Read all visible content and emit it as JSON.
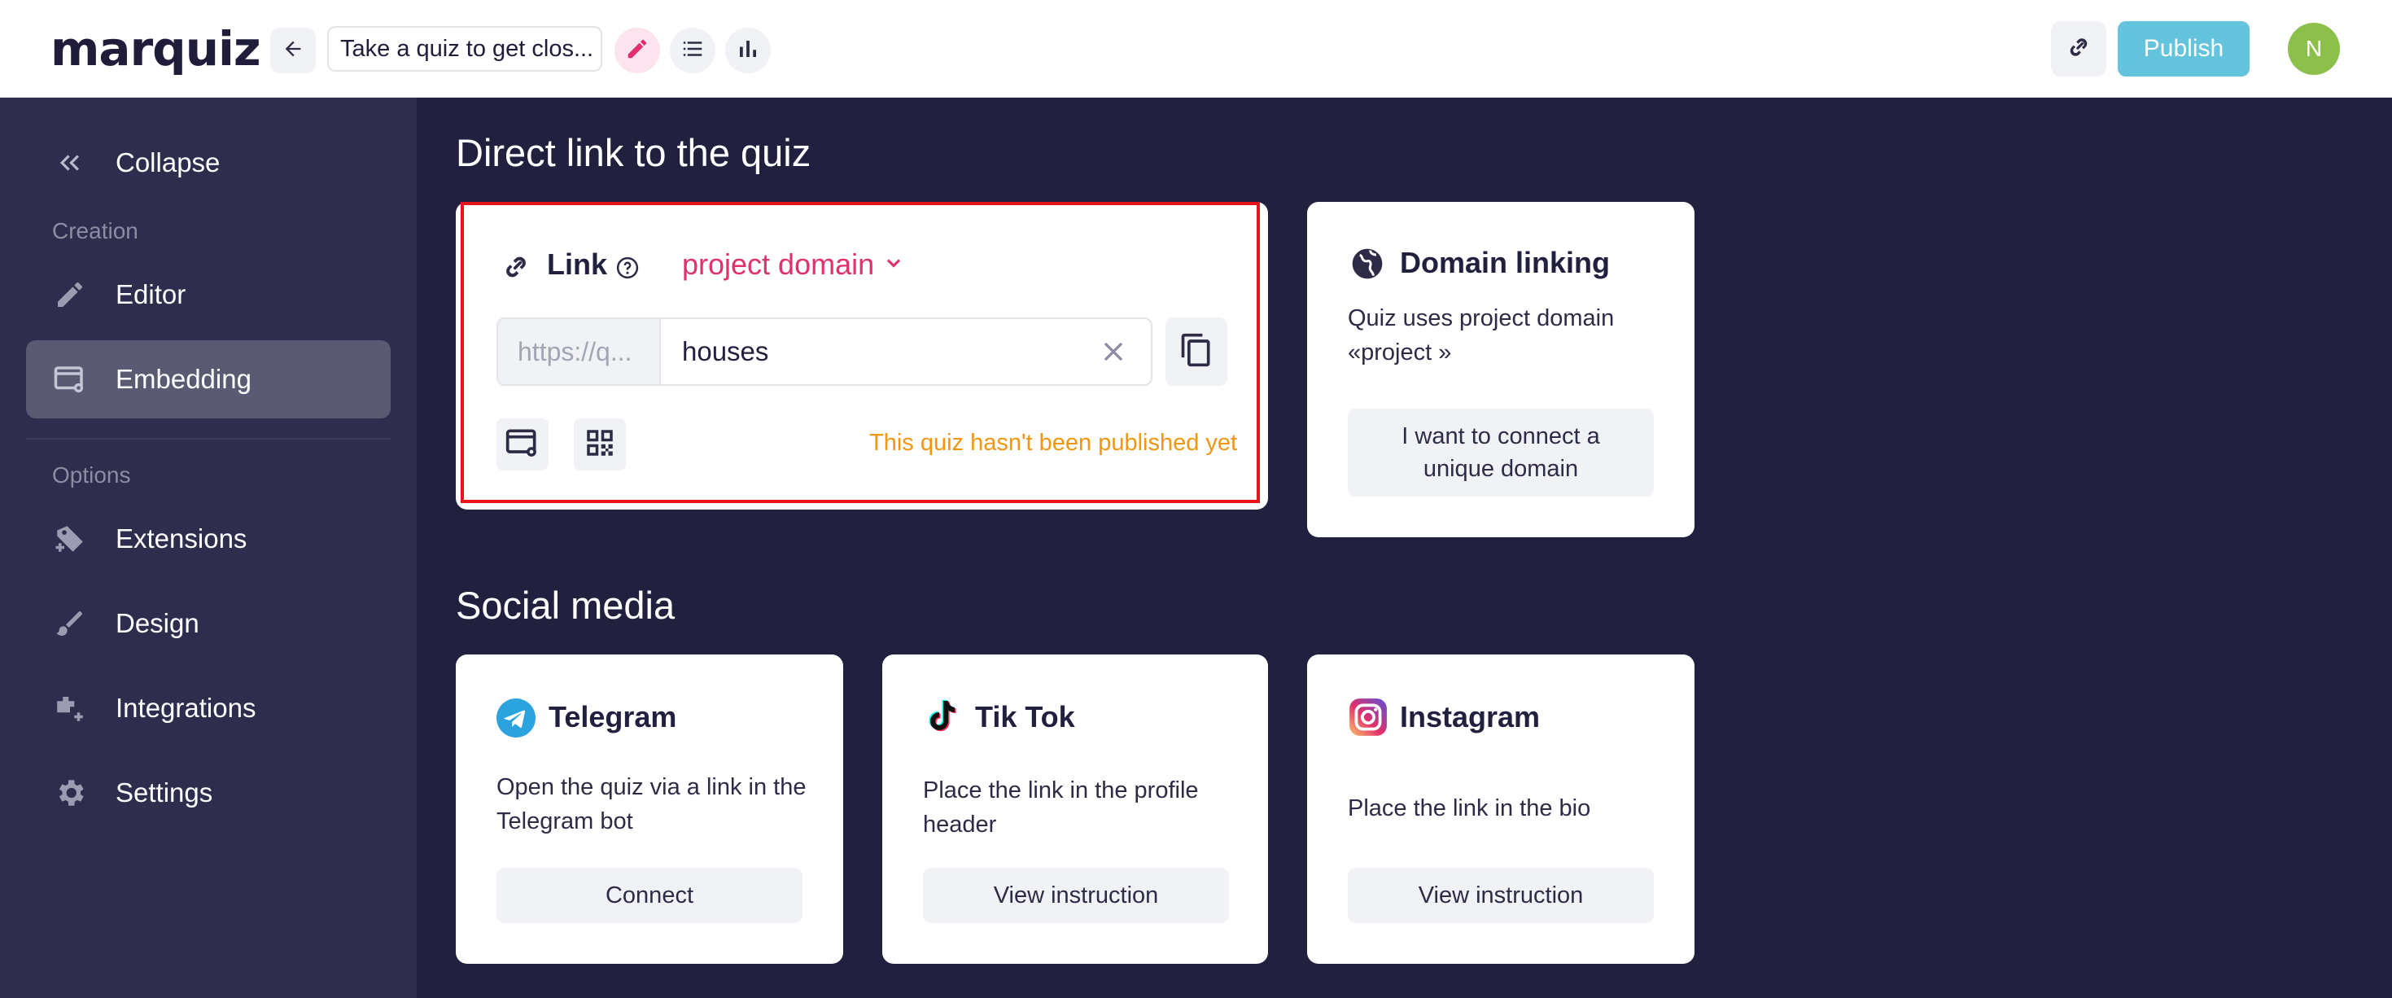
{
  "header": {
    "logo": "marquiz",
    "quiz_title": "Take a quiz to get clos...",
    "publish_label": "Publish",
    "avatar_initial": "N"
  },
  "sidebar": {
    "collapse_label": "Collapse",
    "section_creation": "Creation",
    "section_options": "Options",
    "items": [
      {
        "label": "Editor",
        "icon": "pencil-icon"
      },
      {
        "label": "Embedding",
        "icon": "embed-icon",
        "active": true
      },
      {
        "label": "Extensions",
        "icon": "puzzle-icon"
      },
      {
        "label": "Design",
        "icon": "brush-icon"
      },
      {
        "label": "Integrations",
        "icon": "integrations-icon"
      },
      {
        "label": "Settings",
        "icon": "gear-icon"
      }
    ]
  },
  "direct_link": {
    "section_title": "Direct link to the quiz",
    "link_label": "Link",
    "domain_select": "project domain",
    "url_prefix": "https://q...",
    "url_value": "houses",
    "status": "This quiz hasn't been published yet"
  },
  "domain_linking": {
    "title": "Domain linking",
    "description": "Quiz uses project domain «project »",
    "button": "I want to connect a unique domain"
  },
  "social": {
    "section_title": "Social media",
    "cards": [
      {
        "title": "Telegram",
        "description": "Open the quiz via a link in the Telegram bot",
        "button": "Connect",
        "icon": "telegram-icon"
      },
      {
        "title": "Tik Tok",
        "description": "Place the link in the profile header",
        "button": "View instruction",
        "icon": "tiktok-icon"
      },
      {
        "title": "Instagram",
        "description": "Place the link in the bio",
        "button": "View instruction",
        "icon": "instagram-icon"
      }
    ]
  },
  "colors": {
    "accent_pink": "#e0306e",
    "publish_blue": "#64c3dd",
    "warning_orange": "#f0960f",
    "sidebar_bg": "#2f2d4d",
    "main_bg": "#22203f"
  }
}
